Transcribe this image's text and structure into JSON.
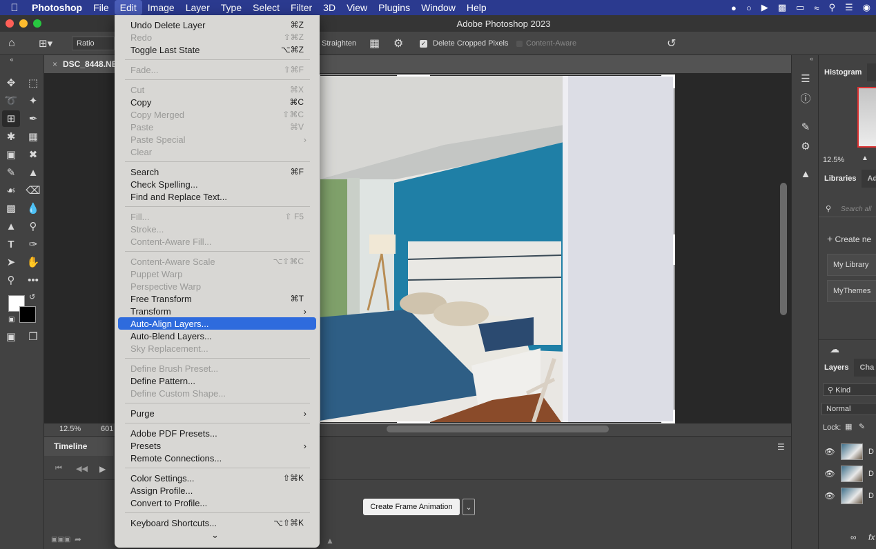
{
  "menubar": {
    "app": "Photoshop",
    "items": [
      "File",
      "Edit",
      "Image",
      "Layer",
      "Type",
      "Select",
      "Filter",
      "3D",
      "View",
      "Plugins",
      "Window",
      "Help"
    ],
    "active": "Edit"
  },
  "window": {
    "title": "Adobe Photoshop 2023"
  },
  "options": {
    "ratio_label": "Ratio",
    "straighten_label": "Straighten",
    "delete_cropped_label": "Delete Cropped Pixels",
    "content_aware_label": "Content-Aware"
  },
  "document": {
    "tab_name": "DSC_8448.NE",
    "zoom": "12.5%",
    "status_partial": "601"
  },
  "timeline": {
    "tab": "Timeline",
    "create_button": "Create Frame Animation"
  },
  "panels": {
    "histogram_tab": "Histogram",
    "zoom": "12.5%",
    "libraries_tab": "Libraries",
    "libraries_tab2": "Ad",
    "search_placeholder": "Search all",
    "create_new": "Create ne",
    "library_items": [
      "My Library",
      "MyThemes"
    ],
    "layers_tab": "Layers",
    "channels_tab": "Cha",
    "kind_filter": "Kind",
    "blend_mode": "Normal",
    "lock_label": "Lock:",
    "layer_names": [
      "D",
      "D",
      "D"
    ]
  },
  "edit_menu": {
    "items": [
      {
        "label": "Undo Delete Layer",
        "shortcut": "⌘Z",
        "disabled": false
      },
      {
        "label": "Redo",
        "shortcut": "⇧⌘Z",
        "disabled": true
      },
      {
        "label": "Toggle Last State",
        "shortcut": "⌥⌘Z",
        "disabled": false
      },
      {
        "sep": true
      },
      {
        "label": "Fade...",
        "shortcut": "⇧⌘F",
        "disabled": true
      },
      {
        "sep": true
      },
      {
        "label": "Cut",
        "shortcut": "⌘X",
        "disabled": true
      },
      {
        "label": "Copy",
        "shortcut": "⌘C",
        "disabled": false
      },
      {
        "label": "Copy Merged",
        "shortcut": "⇧⌘C",
        "disabled": true
      },
      {
        "label": "Paste",
        "shortcut": "⌘V",
        "disabled": true
      },
      {
        "label": "Paste Special",
        "submenu": true,
        "disabled": true
      },
      {
        "label": "Clear",
        "disabled": true
      },
      {
        "sep": true
      },
      {
        "label": "Search",
        "shortcut": "⌘F",
        "disabled": false
      },
      {
        "label": "Check Spelling...",
        "disabled": false
      },
      {
        "label": "Find and Replace Text...",
        "disabled": false
      },
      {
        "sep": true
      },
      {
        "label": "Fill...",
        "shortcut": "⇧ F5",
        "disabled": true
      },
      {
        "label": "Stroke...",
        "disabled": true
      },
      {
        "label": "Content-Aware Fill...",
        "disabled": true
      },
      {
        "sep": true
      },
      {
        "label": "Content-Aware Scale",
        "shortcut": "⌥⇧⌘C",
        "disabled": true
      },
      {
        "label": "Puppet Warp",
        "disabled": true
      },
      {
        "label": "Perspective Warp",
        "disabled": true
      },
      {
        "label": "Free Transform",
        "shortcut": "⌘T",
        "disabled": false
      },
      {
        "label": "Transform",
        "submenu": true,
        "disabled": false
      },
      {
        "label": "Auto-Align Layers...",
        "disabled": false,
        "highlighted": true
      },
      {
        "label": "Auto-Blend Layers...",
        "disabled": false
      },
      {
        "label": "Sky Replacement...",
        "disabled": true
      },
      {
        "sep": true
      },
      {
        "label": "Define Brush Preset...",
        "disabled": true
      },
      {
        "label": "Define Pattern...",
        "disabled": false
      },
      {
        "label": "Define Custom Shape...",
        "disabled": true
      },
      {
        "sep": true
      },
      {
        "label": "Purge",
        "submenu": true,
        "disabled": false
      },
      {
        "sep": true
      },
      {
        "label": "Adobe PDF Presets...",
        "disabled": false
      },
      {
        "label": "Presets",
        "submenu": true,
        "disabled": false
      },
      {
        "label": "Remote Connections...",
        "disabled": false
      },
      {
        "sep": true
      },
      {
        "label": "Color Settings...",
        "shortcut": "⇧⌘K",
        "disabled": false
      },
      {
        "label": "Assign Profile...",
        "disabled": false
      },
      {
        "label": "Convert to Profile...",
        "disabled": false
      },
      {
        "sep": true
      },
      {
        "label": "Keyboard Shortcuts...",
        "shortcut": "⌥⇧⌘K",
        "disabled": false
      }
    ]
  },
  "colors": {
    "menubar_bg": "#2b3a8f",
    "highlight": "#2e6bdd",
    "wall_blue": "#1f7fa6"
  }
}
